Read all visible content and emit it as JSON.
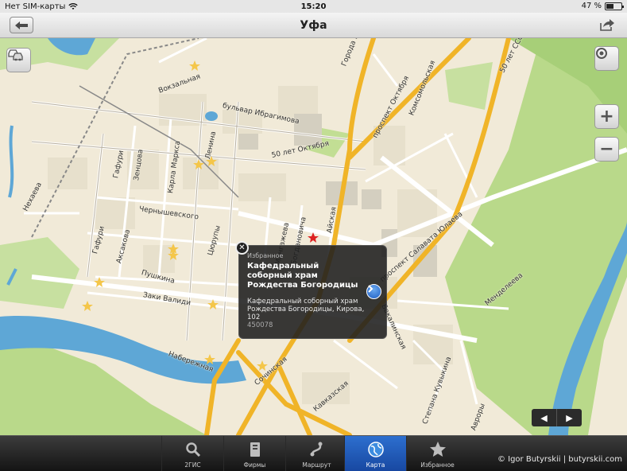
{
  "status_bar": {
    "carrier": "Нет SIM-карты",
    "time": "15:20",
    "battery": "47 %",
    "battery_level": 0.47
  },
  "nav_bar": {
    "title": "Уфа",
    "back_icon": "back-arrow-icon",
    "share_icon": "share-icon"
  },
  "map": {
    "traffic_icon": "traffic-cars-icon",
    "locate_icon": "locate-icon",
    "zoom_in_label": "+",
    "zoom_out_label": "−",
    "street_labels": {
      "gorodagalle": "Города Галле",
      "oktyabrya": "проспект Октября",
      "komsomolskaya": "Комсомольская",
      "sssr": "50 лет СССР",
      "vokzalnaya": "Вокзальная",
      "ibragimova": "бульвар Ибрагимова",
      "lenina": "Ленина",
      "let50": "50 лет Октября",
      "gafuri1": "Гафури",
      "zenzova": "Зенцова",
      "karlamarksa": "Карла Маркса",
      "chernyshevskogo": "Чернышевского",
      "nekhaeva": "Нехаева",
      "gafuri2": "Гафури",
      "aksakova": "Аксакова",
      "tsyurupy": "Цюрупы",
      "mingazheva": "Мингажева",
      "bogdanova": "Богдановича",
      "aksayskaya": "Айская",
      "salavata": "проспект Салавата Юлаева",
      "pushkina": "Пушкина",
      "zakivalidi": "Заки Валиди",
      "naberezhnaya": "Набережная",
      "bakalinskaya": "Бакалинская",
      "mendeleeva": "Менделеева",
      "sochinskaya": "Сочинская",
      "kavkazskaya": "Кавказская",
      "kuvykina": "Степана Кувыкина",
      "avrory": "Авроры"
    }
  },
  "popup": {
    "category": "Избранное",
    "name": "Кафедральный соборный храм Рождества Богородицы",
    "address": "Кафедральный соборный храм Рождества Богородицы, Кирова, 102",
    "zip": "450078",
    "close_icon": "close-icon",
    "details_icon": "chevron-right-icon"
  },
  "pager": {
    "prev": "◀",
    "next": "▶"
  },
  "tab_bar": {
    "tabs": [
      {
        "label": "2ГИС",
        "icon": "search-icon"
      },
      {
        "label": "Фирмы",
        "icon": "book-icon"
      },
      {
        "label": "Маршрут",
        "icon": "route-icon"
      },
      {
        "label": "Карта",
        "icon": "globe-icon"
      },
      {
        "label": "Избранное",
        "icon": "star-icon"
      }
    ],
    "active_tab": "Карта"
  },
  "watermark": "© Igor Butyrskii | butyrskii.com",
  "colors": {
    "map_background": "#f1ead8",
    "water": "#5ea7d6",
    "park": "#b9d98a",
    "major_road": "#f0b428",
    "active_tab": "#2d6fcf"
  }
}
